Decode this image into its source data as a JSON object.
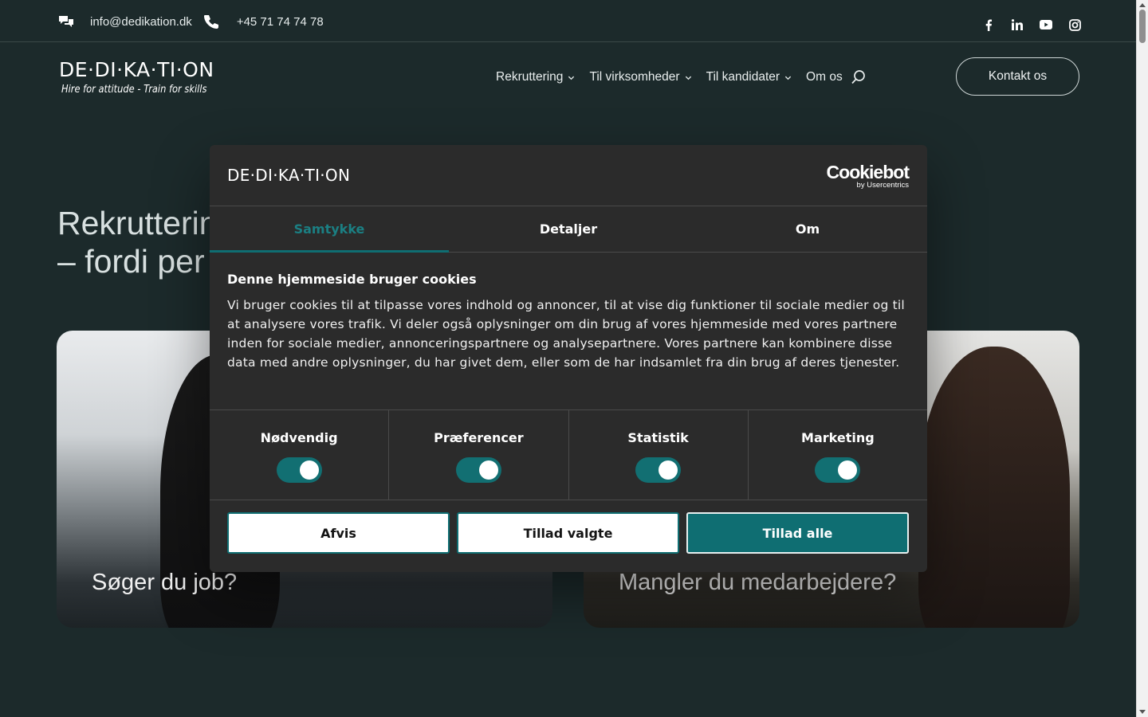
{
  "topbar": {
    "email": "info@dedikation.dk",
    "phone": "+45 71 74 74 78",
    "social": [
      "facebook-icon",
      "linkedin-icon",
      "youtube-icon",
      "instagram-icon"
    ]
  },
  "header": {
    "logo_mark": "DE·DI·KA·TI·ON",
    "logo_tagline": "Hire for attitude - Train for skills",
    "nav": [
      {
        "label": "Rekruttering"
      },
      {
        "label": "Til virksomheder"
      },
      {
        "label": "Til kandidater"
      },
      {
        "label": "Om os"
      }
    ],
    "cta": "Kontakt os"
  },
  "hero": {
    "title_line1": "Rekrutterin",
    "title_line2": "– fordi per",
    "cards": [
      {
        "label": "Søger du job?"
      },
      {
        "label": "Mangler du medarbejdere?"
      }
    ]
  },
  "cookie_dialog": {
    "logo": "DE·DI·KA·TI·ON",
    "brand": "Cookiebot",
    "brand_sub": "by Usercentrics",
    "tabs": [
      "Samtykke",
      "Detaljer",
      "Om"
    ],
    "active_tab": "Samtykke",
    "heading": "Denne hjemmeside bruger cookies",
    "text": "Vi bruger cookies til at tilpasse vores indhold og annoncer, til at vise dig funktioner til sociale medier og til at analysere vores trafik. Vi deler også oplysninger om din brug af vores hjemmeside med vores partnere inden for sociale medier, annonceringspartnere og analysepartnere. Vores partnere kan kombinere disse data med andre oplysninger, du har givet dem, eller som de har indsamlet fra din brug af deres tjenester.",
    "categories": [
      {
        "label": "Nødvendig",
        "enabled": true
      },
      {
        "label": "Præferencer",
        "enabled": true
      },
      {
        "label": "Statistik",
        "enabled": true
      },
      {
        "label": "Marketing",
        "enabled": true
      }
    ],
    "buttons": {
      "reject": "Afvis",
      "allow_selected": "Tillad valgte",
      "allow_all": "Tillad alle"
    },
    "accent_color": "#0f6e72"
  },
  "colors": {
    "background": "#1c2a2b",
    "dialog_bg": "#2b2b2b"
  }
}
